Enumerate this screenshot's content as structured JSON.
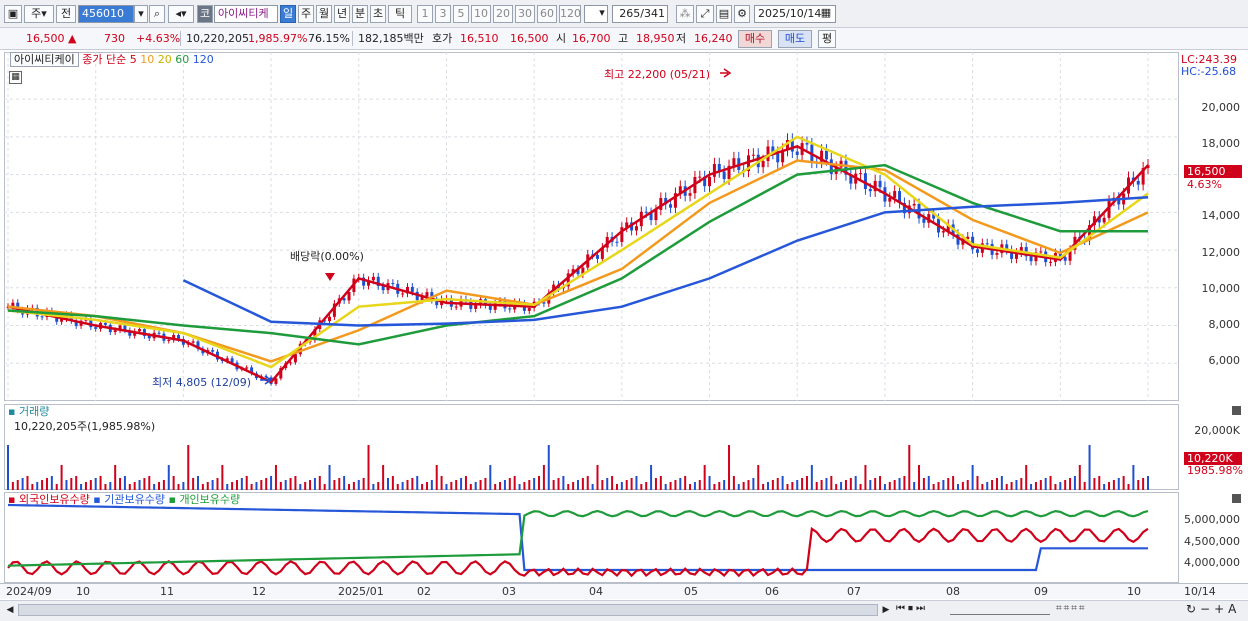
{
  "toolbar": {
    "market_type": "주",
    "prev_label": "전",
    "code": "456010",
    "market_badge": "코",
    "stock_name": "아이씨티케",
    "periods": [
      "일",
      "주",
      "월",
      "년",
      "분",
      "초",
      "틱"
    ],
    "active_period": "일",
    "intervals": [
      "1",
      "3",
      "5",
      "10",
      "20",
      "30",
      "60",
      "120"
    ],
    "count": "265",
    "total": "/341",
    "date": "2025/10/14"
  },
  "quote": {
    "price": "16,500",
    "change": "730",
    "change_pct": "+4.63%",
    "volume": "10,220,205",
    "volume_ratio": "1,985.97%",
    "rate": "76.15%",
    "amount": "182,185백만",
    "bid_label": "호가",
    "bid1": "16,510",
    "bid2": "16,500",
    "open_label": "시",
    "open": "16,700",
    "high_label": "고",
    "high": "18,950",
    "low_label": "저",
    "low": "16,240",
    "buy_label": "매수",
    "sell_label": "매도",
    "eval_label": "평"
  },
  "price_pane": {
    "stock_chip": "아이씨티케이",
    "legend_title": "종가 단순",
    "ma_periods": [
      "5",
      "10",
      "20",
      "60",
      "120"
    ],
    "ma_colors": [
      "#d0021b",
      "#f39a1e",
      "#e8d61b",
      "#1e9b3a",
      "#2657d9"
    ],
    "lc": "LC:243.39",
    "hc": "HC:-25.68",
    "y_ticks": [
      "20,000",
      "18,000",
      "16,000",
      "14,000",
      "12,000",
      "10,000",
      "8,000",
      "6,000"
    ],
    "price_tag": "16,500",
    "pct_tag": "4.63%",
    "max_note": "최고 22,200 (05/21)",
    "min_note": "최저 4,805 (12/09)",
    "dividend_note": "배당락(0.00%)"
  },
  "volume_pane": {
    "title": "거래량",
    "value_note": "10,220,205주(1,985.98%)",
    "y_tick": "20,000K",
    "volume_tag": "10,220K",
    "ratio_tag": "1985.98%"
  },
  "holding_pane": {
    "legend": [
      "외국인보유수량",
      "기관보유수량",
      "개인보유수량"
    ],
    "legend_colors": [
      "#d0021b",
      "#2657d9",
      "#1e9b3a"
    ],
    "y_ticks": [
      "5,000,000",
      "4,500,000",
      "4,000,000"
    ]
  },
  "x_labels": [
    "2024/09",
    "10",
    "11",
    "12",
    "2025/01",
    "02",
    "03",
    "04",
    "05",
    "06",
    "07",
    "08",
    "09",
    "10"
  ],
  "end_date": "10/14",
  "chart_data": {
    "type": "line",
    "title": "",
    "x": [
      "2024/09",
      "10",
      "11",
      "12",
      "2025/01",
      "02",
      "03",
      "04",
      "05",
      "06",
      "07",
      "08",
      "09",
      "10"
    ],
    "series": [
      {
        "name": "종가",
        "values": [
          9000,
          8000,
          7200,
          5000,
          10500,
          9200,
          9000,
          13000,
          16000,
          17500,
          15000,
          12200,
          11500,
          16500
        ]
      },
      {
        "name": "20",
        "values": [
          8800,
          8300,
          7600,
          5800,
          9000,
          9400,
          9100,
          12000,
          15000,
          18000,
          16000,
          12300,
          11600,
          15000
        ]
      },
      {
        "name": "60",
        "values": [
          8800,
          8500,
          8000,
          7600,
          7000,
          8000,
          8500,
          10500,
          13500,
          16000,
          16500,
          14500,
          13000,
          13000
        ]
      },
      {
        "name": "120",
        "values": [
          null,
          null,
          10400,
          8200,
          8000,
          8100,
          8300,
          9000,
          10500,
          12500,
          14000,
          14300,
          14500,
          14800
        ]
      }
    ],
    "ylim": [
      4000,
      22500
    ]
  }
}
